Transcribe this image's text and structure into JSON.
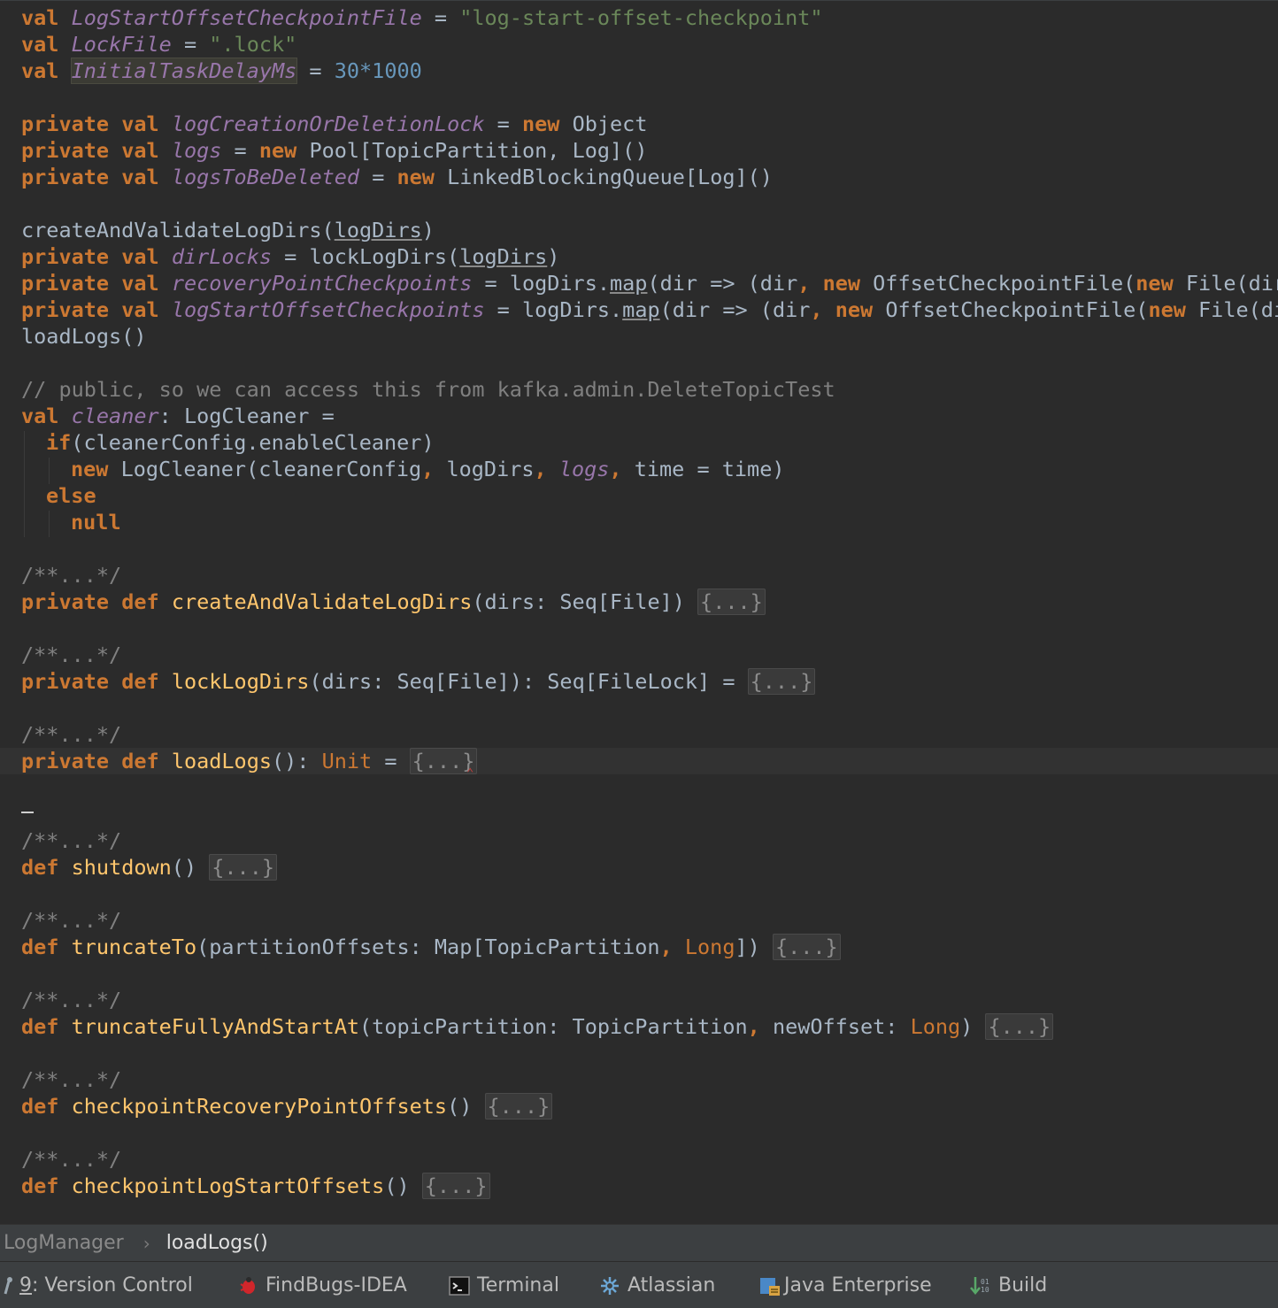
{
  "editor": {
    "line_01": {
      "kw": "val",
      "field": "LogStartOffsetCheckpointFile",
      "op": " = ",
      "str": "\"log-start-offset-checkpoint\""
    },
    "line_02": {
      "kw": "val",
      "field": "LockFile",
      "op": " = ",
      "str": "\".lock\""
    },
    "line_03": {
      "kw": "val",
      "field": "InitialTaskDelayMs",
      "op": " = ",
      "num": "30*1000"
    },
    "line_05": {
      "kw1": "private",
      "kw2": "val",
      "field": "logCreationOrDeletionLock",
      "op": " = ",
      "kw3": "new",
      "rest": " Object"
    },
    "line_06": {
      "kw1": "private",
      "kw2": "val",
      "field": "logs",
      "op": " = ",
      "kw3": "new",
      "rest": " Pool[TopicPartition, Log]()"
    },
    "line_07": {
      "kw1": "private",
      "kw2": "val",
      "field": "logsToBeDeleted",
      "op": " = ",
      "kw3": "new",
      "rest": " LinkedBlockingQueue[Log]()"
    },
    "line_09": {
      "call": "createAndValidateLogDirs(",
      "arg": "logDirs",
      "end": ")"
    },
    "line_10": {
      "kw1": "private",
      "kw2": "val",
      "field": "dirLocks",
      "op": " = lockLogDirs(",
      "arg": "logDirs",
      "end": ")"
    },
    "line_11": {
      "kw1": "private",
      "kw2": "val",
      "field": "recoveryPointCheckpoints",
      "op": " = logDirs.",
      "map": "map",
      "rest1": "(dir => (dir",
      "comma": ",",
      "kw3": "new",
      "rest2": " OffsetCheckpointFile(",
      "kw4": "new",
      "rest3": " File(dir,"
    },
    "line_12": {
      "kw1": "private",
      "kw2": "val",
      "field": "logStartOffsetCheckpoints",
      "op": " = logDirs.",
      "map": "map",
      "rest1": "(dir => (dir",
      "comma": ",",
      "kw3": "new",
      "rest2": " OffsetCheckpointFile(",
      "kw4": "new",
      "rest3": " File(dir"
    },
    "line_13": {
      "text": "loadLogs()"
    },
    "line_15": {
      "comment": "// public, so we can access this from kafka.admin.DeleteTopicTest"
    },
    "line_16": {
      "kw": "val",
      "field": "cleaner",
      "rest": ": LogCleaner ="
    },
    "line_17": {
      "kw": "if",
      "rest": "(cleanerConfig.enableCleaner)"
    },
    "line_18": {
      "kw": "new",
      "rest1": " LogCleaner(cleanerConfig",
      "c1": ",",
      "rest2": " logDirs",
      "c2": ",",
      "field": "logs",
      "c3": ",",
      "rest3": " time = time)"
    },
    "line_19": {
      "kw": "else"
    },
    "line_20": {
      "kw": "null"
    },
    "doc_comment": "/**...*/",
    "fold": "{...}",
    "line_23": {
      "kw1": "private",
      "kw2": "def",
      "fn": "createAndValidateLogDirs",
      "rest": "(dirs: Seq[File]) "
    },
    "line_26": {
      "kw1": "private",
      "kw2": "def",
      "fn": "lockLogDirs",
      "rest": "(dirs: Seq[File]): Seq[FileLock] = "
    },
    "line_29": {
      "kw1": "private",
      "kw2": "def",
      "fn": "loadLogs",
      "rest": "(): ",
      "type": "Unit",
      "eq": " = "
    },
    "line_33": {
      "kw": "def",
      "fn": "shutdown",
      "rest": "() "
    },
    "line_36": {
      "kw": "def",
      "fn": "truncateTo",
      "rest1": "(partitionOffsets: Map[TopicPartition",
      "comma": ",",
      "type": "Long",
      "rest2": "]) "
    },
    "line_39": {
      "kw": "def",
      "fn": "truncateFullyAndStartAt",
      "rest1": "(topicPartition: TopicPartition",
      "comma": ",",
      "rest2": " newOffset: ",
      "type": "Long",
      "rest3": ") "
    },
    "line_42": {
      "kw": "def",
      "fn": "checkpointRecoveryPointOffsets",
      "rest": "() "
    },
    "line_45": {
      "kw": "def",
      "fn": "checkpointLogStartOffsets",
      "rest": "() "
    }
  },
  "breadcrumb": {
    "parent": "LogManager",
    "separator": "›",
    "current": "loadLogs()"
  },
  "toolbar": {
    "items": [
      {
        "mnemonic": "9",
        "label": ": Version Control",
        "icon": "version-control-icon"
      },
      {
        "label": "FindBugs-IDEA",
        "icon": "findbugs-icon"
      },
      {
        "label": "Terminal",
        "icon": "terminal-icon"
      },
      {
        "label": "Atlassian",
        "icon": "atlassian-icon"
      },
      {
        "label": "Java Enterprise",
        "icon": "java-enterprise-icon"
      },
      {
        "label": "Build",
        "icon": "build-icon"
      }
    ]
  },
  "colors": {
    "background": "#2b2b2b",
    "keyword": "#cc7832",
    "field": "#9876aa",
    "string": "#6a8759",
    "number": "#6897bb",
    "comment": "#808080",
    "function": "#ffc66d",
    "text": "#a9b7c6"
  }
}
